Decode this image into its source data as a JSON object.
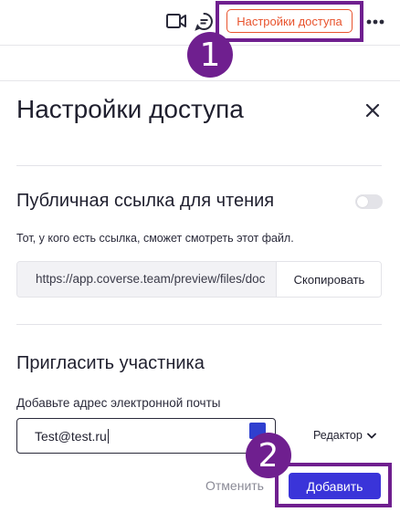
{
  "header": {
    "access_button_label": "Настройки доступа",
    "step1_badge": "1",
    "icons": [
      "video-icon",
      "comment-icon",
      "more-icon"
    ]
  },
  "panel": {
    "title": "Настройки доступа",
    "public_link": {
      "title": "Публичная ссылка для чтения",
      "description": "Тот, у кого есть ссылка, сможет смотреть этот файл.",
      "url": "https://app.coverse.team/preview/files/doc",
      "copy_label": "Скопировать",
      "enabled": false
    },
    "invite": {
      "title": "Пригласить участника",
      "email_label": "Добавьте адрес электронной почты",
      "email_value": "Test@test.ru",
      "role_value": "Редактор",
      "cancel_label": "Отменить",
      "add_label": "Добавить",
      "step2_badge": "2"
    }
  },
  "colors": {
    "accent": "#3a34d9",
    "access_button": "#e8532d",
    "highlight": "#6f1f8f"
  }
}
